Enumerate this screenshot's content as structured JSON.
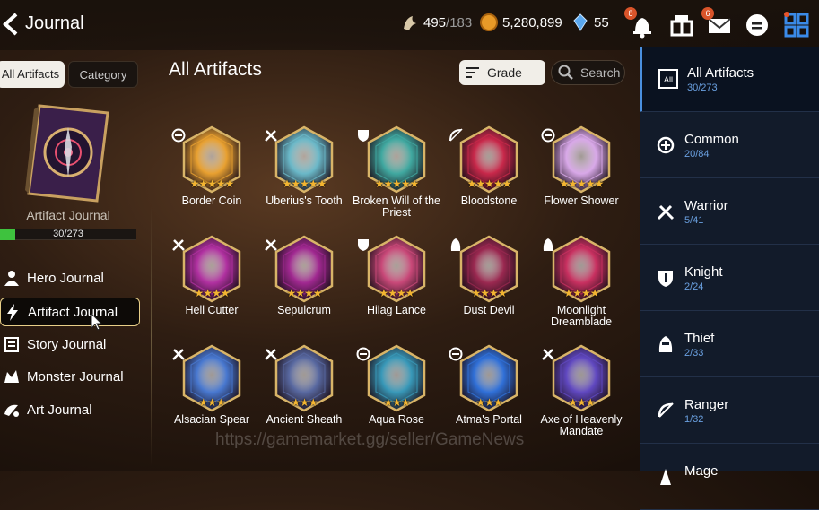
{
  "header": {
    "title": "Journal"
  },
  "currencies": [
    {
      "icon": "stamina-icon",
      "value": "495",
      "max": "/183"
    },
    {
      "icon": "gold-icon",
      "value": "5,280,899",
      "max": ""
    },
    {
      "icon": "skystone-icon",
      "value": "55",
      "max": ""
    }
  ],
  "top_icons": {
    "notifications_badge": "8",
    "mail_badge": "6"
  },
  "left": {
    "seg_all": "All Artifacts",
    "seg_category": "Category",
    "book_label": "Artifact Journal",
    "progress_text": "30/273",
    "progress_fraction": 0.11,
    "nav": [
      {
        "label": "Hero Journal",
        "icon": "hero-icon"
      },
      {
        "label": "Artifact Journal",
        "icon": "lightning-icon"
      },
      {
        "label": "Story Journal",
        "icon": "scroll-icon"
      },
      {
        "label": "Monster Journal",
        "icon": "monster-icon"
      },
      {
        "label": "Art Journal",
        "icon": "art-icon"
      }
    ]
  },
  "main": {
    "title": "All Artifacts",
    "sort_label": "Grade",
    "search_label": "Search",
    "artifacts": [
      {
        "name": "Border Coin",
        "stars": 5,
        "class": "common",
        "color": "#e8a030"
      },
      {
        "name": "Uberius's Tooth",
        "stars": 5,
        "class": "warrior",
        "color": "#6ab8c8"
      },
      {
        "name": "Broken Will of the Priest",
        "stars": 5,
        "class": "knight",
        "color": "#40a8a0"
      },
      {
        "name": "Bloodstone",
        "stars": 5,
        "class": "ranger",
        "color": "#c8284a"
      },
      {
        "name": "Flower Shower",
        "stars": 5,
        "class": "common",
        "color": "#d8a8e8"
      },
      {
        "name": "Hell Cutter",
        "stars": 4,
        "class": "warrior",
        "color": "#b030a0"
      },
      {
        "name": "Sepulcrum",
        "stars": 4,
        "class": "warrior",
        "color": "#a02890"
      },
      {
        "name": "Hilag Lance",
        "stars": 4,
        "class": "knight",
        "color": "#c84878"
      },
      {
        "name": "Dust Devil",
        "stars": 4,
        "class": "thief",
        "color": "#9a2850"
      },
      {
        "name": "Moonlight Dreamblade",
        "stars": 4,
        "class": "thief",
        "color": "#c83060"
      },
      {
        "name": "Alsacian Spear",
        "stars": 3,
        "class": "warrior",
        "color": "#4878d0"
      },
      {
        "name": "Ancient Sheath",
        "stars": 3,
        "class": "warrior",
        "color": "#5868a0"
      },
      {
        "name": "Aqua Rose",
        "stars": 3,
        "class": "common",
        "color": "#3898b8"
      },
      {
        "name": "Atma's Portal",
        "stars": 3,
        "class": "common",
        "color": "#3070d8"
      },
      {
        "name": "Axe of Heavenly Mandate",
        "stars": 3,
        "class": "warrior",
        "color": "#6048c0"
      }
    ]
  },
  "right": [
    {
      "name": "All Artifacts",
      "count": "30/273",
      "icon": "all-icon"
    },
    {
      "name": "Common",
      "count": "20/84",
      "icon": "common-icon"
    },
    {
      "name": "Warrior",
      "count": "5/41",
      "icon": "warrior-icon"
    },
    {
      "name": "Knight",
      "count": "2/24",
      "icon": "knight-icon"
    },
    {
      "name": "Thief",
      "count": "2/33",
      "icon": "thief-icon"
    },
    {
      "name": "Ranger",
      "count": "1/32",
      "icon": "ranger-icon"
    },
    {
      "name": "Mage",
      "count": "",
      "icon": "mage-icon"
    }
  ],
  "watermark": "https://gamemarket.gg/seller/GameNews"
}
